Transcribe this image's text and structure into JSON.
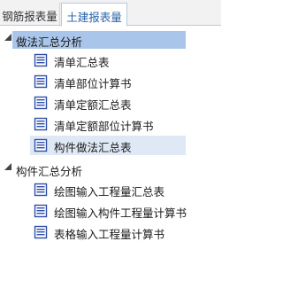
{
  "tabs": [
    {
      "label": "钢筋报表量",
      "active": false
    },
    {
      "label": "土建报表量",
      "active": true
    }
  ],
  "tree": {
    "groups": [
      {
        "label": "做法汇总分析",
        "expanded": true,
        "selected": true,
        "items": [
          {
            "label": "清单汇总表",
            "icon": "document-list-icon"
          },
          {
            "label": "清单部位计算书",
            "icon": "document-list-icon"
          },
          {
            "label": "清单定额汇总表",
            "icon": "document-list-icon"
          },
          {
            "label": "清单定额部位计算书",
            "icon": "document-list-icon"
          },
          {
            "label": "构件做法汇总表",
            "icon": "document-list-icon",
            "highlighted": true
          }
        ]
      },
      {
        "label": "构件汇总分析",
        "expanded": true,
        "selected": false,
        "items": [
          {
            "label": "绘图输入工程量汇总表",
            "icon": "document-list-icon"
          },
          {
            "label": "绘图输入构件工程量计算书",
            "icon": "document-list-icon"
          },
          {
            "label": "表格输入工程量计算书",
            "icon": "document-list-icon"
          }
        ]
      }
    ]
  },
  "colors": {
    "active_tab_text": "#2a62a8",
    "selected_group_bg": "#a9c6ea",
    "hover_item_bg": "#dfe8f5",
    "icon_blue": "#2f4fa8"
  }
}
